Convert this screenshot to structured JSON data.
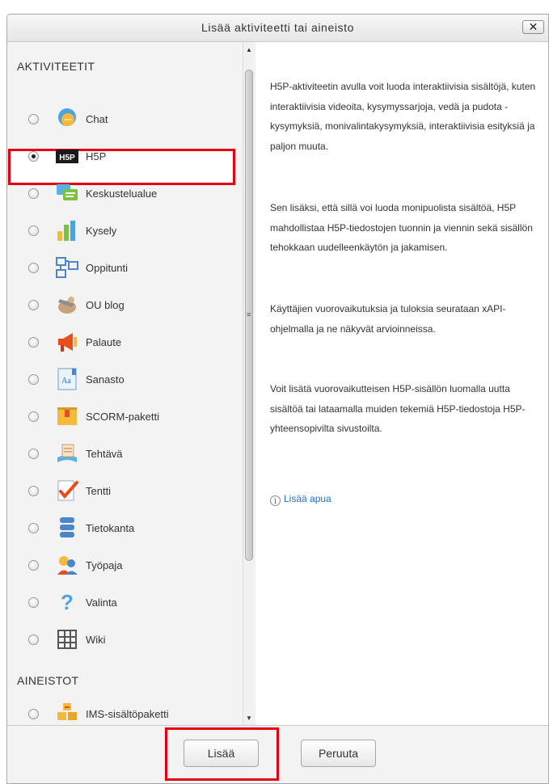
{
  "dialog": {
    "title": "Lisää aktiviteetti tai aineisto",
    "close_label": "✕"
  },
  "sections": {
    "activities": "AKTIVITEETIT",
    "resources": "AINEISTOT"
  },
  "options": [
    {
      "label": "Chat",
      "icon": "chat-icon",
      "selected": false
    },
    {
      "label": "H5P",
      "icon": "h5p-icon",
      "selected": true
    },
    {
      "label": "Keskustelualue",
      "icon": "forum-icon",
      "selected": false
    },
    {
      "label": "Kysely",
      "icon": "survey-icon",
      "selected": false
    },
    {
      "label": "Oppitunti",
      "icon": "lesson-icon",
      "selected": false
    },
    {
      "label": "OU blog",
      "icon": "blog-icon",
      "selected": false
    },
    {
      "label": "Palaute",
      "icon": "feedback-icon",
      "selected": false
    },
    {
      "label": "Sanasto",
      "icon": "glossary-icon",
      "selected": false
    },
    {
      "label": "SCORM-paketti",
      "icon": "scorm-icon",
      "selected": false
    },
    {
      "label": "Tehtävä",
      "icon": "assignment-icon",
      "selected": false
    },
    {
      "label": "Tentti",
      "icon": "quiz-icon",
      "selected": false
    },
    {
      "label": "Tietokanta",
      "icon": "database-icon",
      "selected": false
    },
    {
      "label": "Työpaja",
      "icon": "workshop-icon",
      "selected": false
    },
    {
      "label": "Valinta",
      "icon": "choice-icon",
      "selected": false
    },
    {
      "label": "Wiki",
      "icon": "wiki-icon",
      "selected": false
    }
  ],
  "resource_options": [
    {
      "label": "IMS-sisältöpaketti",
      "icon": "ims-package-icon",
      "selected": false
    }
  ],
  "help": {
    "paragraphs": [
      "H5P-aktiviteetin avulla voit luoda interaktiivisia sisältöjä, kuten interaktiivisia videoita, kysymyssarjoja, vedä ja pudota -kysymyksiä, monivalintakysymyksiä, interaktiivisia esityksiä ja paljon muuta.",
      "Sen lisäksi, että sillä voi luoda monipuolista sisältöä, H5P mahdollistaa H5P-tiedostojen tuonnin ja viennin sekä sisällön tehokkaan uudelleenkäytön ja jakamisen.",
      "Käyttäjien vuorovaikutuksia ja tuloksia seurataan xAPI-ohjelmalla ja ne näkyvät arvioinneissa.",
      "Voit lisätä vuorovaikutteisen H5P-sisällön luomalla uutta sisältöä tai lataamalla muiden tekemiä H5P-tiedostoja H5P-yhteensopivilta sivustoilta."
    ],
    "link_label": "Lisää apua"
  },
  "footer": {
    "add_label": "Lisää",
    "cancel_label": "Peruuta"
  },
  "colors": {
    "highlight": "#e3000f",
    "link": "#1a73c8",
    "panel_bg": "#f3f3f3"
  }
}
